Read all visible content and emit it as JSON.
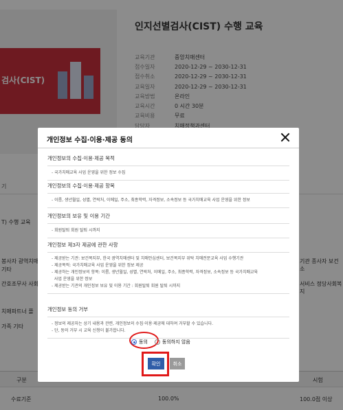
{
  "course": {
    "title": "인지선별검사(CIST) 수행 교육",
    "banner_text": "검사(CIST)",
    "info": [
      {
        "key": "교육기관",
        "value": "중앙치매센터"
      },
      {
        "key": "접수일자",
        "value": "2020-12-29 ~ 2030-12-31"
      },
      {
        "key": "접수취소",
        "value": "2020-12-29 ~ 2030-12-31"
      },
      {
        "key": "교육일자",
        "value": "2020-12-29 ~ 2030-12-31"
      },
      {
        "key": "교육방법",
        "value": "온라인"
      },
      {
        "key": "교육시간",
        "value": "0 시간 30분"
      },
      {
        "key": "교육비용",
        "value": "무료"
      },
      {
        "key": "담당자",
        "value": "치매정책과센터"
      }
    ]
  },
  "background": {
    "tab_label": "기",
    "side_text_1": "T) 수행 교육",
    "side_text_2": "봉사자 광역치매",
    "side_text_3": "기타",
    "side_text_4": "간호조무사 사회복",
    "side_text_5": "치매파트너 플",
    "side_text_6": "가족 기타",
    "right_text_1": "기관 종사자 보건소",
    "right_text_2": "서비스 정당사회복지",
    "table_header_left": "구분",
    "table_header_right": "시험",
    "table_row_label": "수료기준",
    "table_row_mid": "100.0%",
    "table_row_right": "100.0점 이상"
  },
  "modal": {
    "title": "개인정보 수집·이용·제공 동의",
    "sections": [
      {
        "title": "개인정보의 수집·이용·제공 목적",
        "lines": [
          "- 국가치매교육 사업 운영을 위한 정보 수집"
        ]
      },
      {
        "title": "개인정보의 수집·이용·제공 항목",
        "lines": [
          "- 이름, 생년월일, 성별, 연락처, 이메일, 주소, 최종학력, 자격정보, 소속정보 등 국가치매교육 사업 운영을 위한 정보"
        ]
      },
      {
        "title": "개인정보의 보유 및 이용 기간",
        "lines": [
          "- 회원탈퇴 회원 탈퇴 시까지"
        ]
      },
      {
        "title": "개인정보 제3자 제공에 관한 사항",
        "lines": [
          "- 제공받는 기관: 보건복지부, 한국 광역치매센터 및 치매안심센터, 보건복지부 위탁 치매전문교육 사업 수행기관",
          "- 제공목적: 국가치매교육 사업 운영을 위한 정보 제공",
          "- 제공하는 개인정보의 항목: 이름, 생년월일, 성별, 연락처, 이메일, 주소, 최종학력, 자격정보, 소속정보 등 국가치매교육",
          "  사업 운영을 위한 정보",
          "- 제공받는 기관의 개인정보 보유 및 이용 기간 : 회원탈퇴 회원 탈퇴 시까지"
        ]
      },
      {
        "title": "개인정보 동의 거부",
        "lines": [
          "- 정보의 제공자는 상기 내용과 관련, 개인정보의 수집·이용·제공에 대하여 거부할 수 있습니다.",
          "- 단, 동의 거부 시 교육 신청이 불가합니다."
        ]
      }
    ],
    "agree_label": "동의",
    "disagree_label": "동의하지 않음",
    "ok_label": "확인",
    "cancel_label": "취소"
  },
  "colors": {
    "primary": "#2f5da8",
    "highlight": "#e01818",
    "banner": "#c8303c"
  }
}
